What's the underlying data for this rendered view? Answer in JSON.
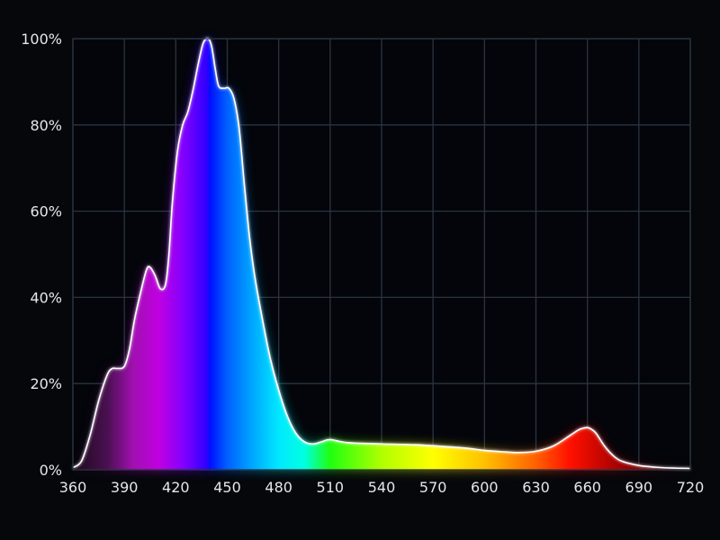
{
  "chart_data": {
    "type": "area",
    "title": "",
    "xlabel": "",
    "ylabel": "",
    "xlim": [
      360,
      720
    ],
    "ylim": [
      0,
      100
    ],
    "x_ticks": [
      360,
      390,
      420,
      450,
      480,
      510,
      540,
      570,
      600,
      630,
      660,
      690,
      720
    ],
    "y_ticks": [
      0,
      20,
      40,
      60,
      80,
      100
    ],
    "y_tick_suffix": "%",
    "grid": true,
    "legend": "none",
    "series": [
      {
        "x": [
          360,
          365,
          370,
          375,
          380,
          383,
          386,
          390,
          393,
          396,
          400,
          403,
          405,
          408,
          411,
          414,
          416,
          418,
          421,
          424,
          427,
          430,
          433,
          436,
          439,
          441,
          443,
          445,
          448,
          451,
          454,
          457,
          460,
          463,
          466,
          470,
          475,
          480,
          485,
          490,
          495,
          500,
          505,
          510,
          520,
          540,
          560,
          580,
          590,
          600,
          610,
          620,
          630,
          640,
          650,
          655,
          658,
          660,
          662,
          665,
          670,
          675,
          680,
          690,
          700,
          710,
          720
        ],
        "y": [
          0.5,
          2,
          8,
          16,
          22,
          23.5,
          23.5,
          24,
          28,
          35,
          42,
          46.5,
          47,
          45,
          42,
          43,
          50,
          62,
          74,
          80,
          83,
          88,
          94,
          99,
          100,
          98,
          93,
          89,
          88.5,
          88.5,
          86,
          79,
          66,
          54,
          45,
          36,
          26,
          18.5,
          12.5,
          8.5,
          6.5,
          6,
          6.5,
          7,
          6.3,
          6,
          5.8,
          5.3,
          5,
          4.5,
          4.2,
          4,
          4.3,
          5.5,
          8,
          9.3,
          9.7,
          9.8,
          9.5,
          8.5,
          5.5,
          3.3,
          2,
          1,
          0.6,
          0.4,
          0.3
        ]
      }
    ]
  },
  "colors": {
    "background": "#05070b",
    "plot_background": "#03050a",
    "grid": "#2a3440",
    "text": "#e6e6e6",
    "curve_stroke": "#ffffff",
    "spectrum_stops": [
      {
        "nm": 360,
        "color": "#1a0a1a"
      },
      {
        "nm": 380,
        "color": "#4a1050"
      },
      {
        "nm": 395,
        "color": "#a010b0"
      },
      {
        "nm": 410,
        "color": "#c000e0"
      },
      {
        "nm": 425,
        "color": "#8000ff"
      },
      {
        "nm": 438,
        "color": "#3000ff"
      },
      {
        "nm": 440,
        "color": "#0010ff"
      },
      {
        "nm": 450,
        "color": "#0060ff"
      },
      {
        "nm": 465,
        "color": "#00a8ff"
      },
      {
        "nm": 480,
        "color": "#00e8ff"
      },
      {
        "nm": 495,
        "color": "#00ffe0"
      },
      {
        "nm": 510,
        "color": "#20ff10"
      },
      {
        "nm": 540,
        "color": "#b0ff00"
      },
      {
        "nm": 570,
        "color": "#ffff00"
      },
      {
        "nm": 600,
        "color": "#ffc000"
      },
      {
        "nm": 630,
        "color": "#ff6000"
      },
      {
        "nm": 650,
        "color": "#ff1000"
      },
      {
        "nm": 680,
        "color": "#a00000"
      },
      {
        "nm": 720,
        "color": "#300000"
      }
    ]
  }
}
